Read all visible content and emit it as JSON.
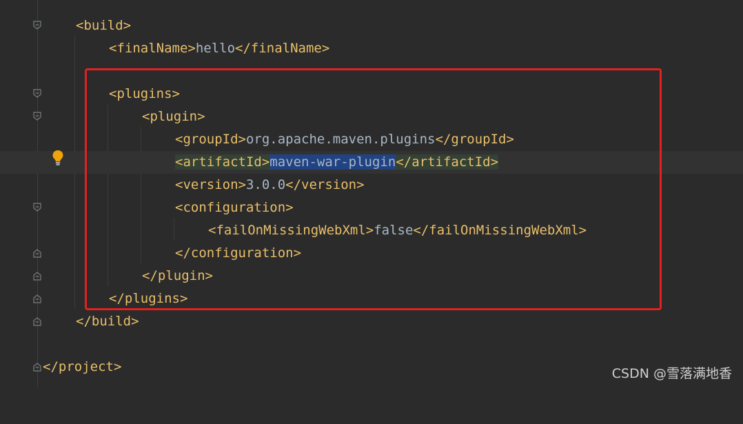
{
  "editor": {
    "lines": [
      {
        "open": "<build>",
        "text": "",
        "close": ""
      },
      {
        "open": "<finalName>",
        "text": "hello",
        "close": "</finalName>"
      },
      {
        "open": "",
        "text": "",
        "close": ""
      },
      {
        "open": "<plugins>",
        "text": "",
        "close": ""
      },
      {
        "open": "<plugin>",
        "text": "",
        "close": ""
      },
      {
        "open": "<groupId>",
        "text": "org.apache.maven.plugins",
        "close": "</groupId>"
      },
      {
        "open": "<artifactId>",
        "text": "maven-war-plugin",
        "close": "</artifactId>"
      },
      {
        "open": "<version>",
        "text": "3.0.0",
        "close": "</version>"
      },
      {
        "open": "<configuration>",
        "text": "",
        "close": ""
      },
      {
        "open": "<failOnMissingWebXml>",
        "text": "false",
        "close": "</failOnMissingWebXml>"
      },
      {
        "open": "</configuration>",
        "text": "",
        "close": ""
      },
      {
        "open": "</plugin>",
        "text": "",
        "close": ""
      },
      {
        "open": "</plugins>",
        "text": "",
        "close": ""
      },
      {
        "open": "</build>",
        "text": "",
        "close": ""
      },
      {
        "open": "",
        "text": "",
        "close": ""
      },
      {
        "open": "</project>",
        "text": "",
        "close": ""
      }
    ]
  },
  "watermark": "CSDN @雪落满地香",
  "colors": {
    "background": "#2b2b2b",
    "tag": "#e8bf6a",
    "text": "#a9b7c6",
    "selection": "#214283",
    "highlight_box": "#e3211f"
  },
  "icons": {
    "bulb": "lightbulb-icon",
    "fold": "fold-marker-icon"
  }
}
